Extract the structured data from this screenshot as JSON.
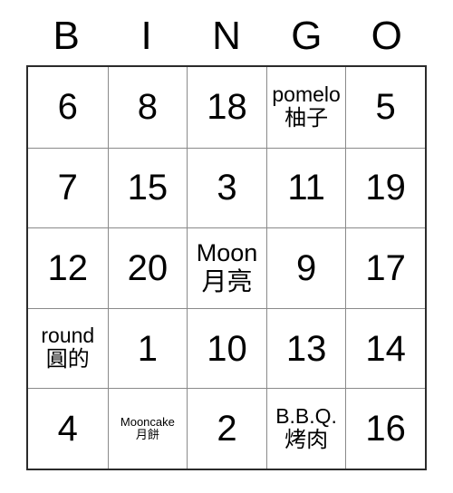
{
  "card": {
    "header": {
      "letters": [
        "B",
        "I",
        "N",
        "G",
        "O"
      ]
    },
    "rows": [
      [
        {
          "primary": "6",
          "secondary": "",
          "kind": "num"
        },
        {
          "primary": "8",
          "secondary": "",
          "kind": "num"
        },
        {
          "primary": "18",
          "secondary": "",
          "kind": "num"
        },
        {
          "primary": "pomelo",
          "secondary": "柚子",
          "kind": "word"
        },
        {
          "primary": "5",
          "secondary": "",
          "kind": "num"
        }
      ],
      [
        {
          "primary": "7",
          "secondary": "",
          "kind": "num"
        },
        {
          "primary": "15",
          "secondary": "",
          "kind": "num"
        },
        {
          "primary": "3",
          "secondary": "",
          "kind": "num"
        },
        {
          "primary": "11",
          "secondary": "",
          "kind": "num"
        },
        {
          "primary": "19",
          "secondary": "",
          "kind": "num"
        }
      ],
      [
        {
          "primary": "12",
          "secondary": "",
          "kind": "num"
        },
        {
          "primary": "20",
          "secondary": "",
          "kind": "num"
        },
        {
          "primary": "Moon",
          "secondary": "月亮",
          "kind": "word lg"
        },
        {
          "primary": "9",
          "secondary": "",
          "kind": "num"
        },
        {
          "primary": "17",
          "secondary": "",
          "kind": "num"
        }
      ],
      [
        {
          "primary": "round",
          "secondary": "圓的",
          "kind": "word"
        },
        {
          "primary": "1",
          "secondary": "",
          "kind": "num"
        },
        {
          "primary": "10",
          "secondary": "",
          "kind": "num"
        },
        {
          "primary": "13",
          "secondary": "",
          "kind": "num"
        },
        {
          "primary": "14",
          "secondary": "",
          "kind": "num"
        }
      ],
      [
        {
          "primary": "4",
          "secondary": "",
          "kind": "num"
        },
        {
          "primary": "Mooncake",
          "secondary": "月餅",
          "kind": "word sm"
        },
        {
          "primary": "2",
          "secondary": "",
          "kind": "num"
        },
        {
          "primary": "B.B.Q.",
          "secondary": "烤肉",
          "kind": "word"
        },
        {
          "primary": "16",
          "secondary": "",
          "kind": "num"
        }
      ]
    ]
  },
  "colors": {
    "outer_border": "#2b2b2b",
    "inner_border": "#8a8a8a",
    "text": "#000000",
    "background": "#ffffff"
  }
}
